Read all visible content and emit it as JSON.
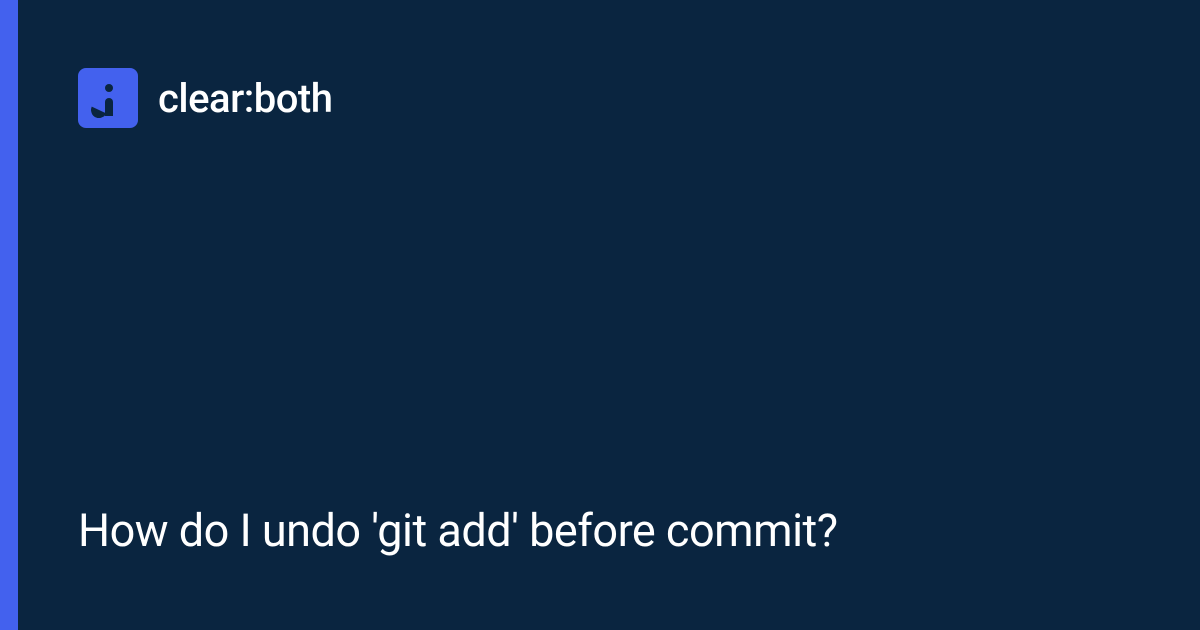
{
  "brand": {
    "name": "clear:both"
  },
  "page": {
    "title": "How do I undo 'git add' before commit?"
  },
  "colors": {
    "background": "#0a2540",
    "accent": "#4361ee",
    "text": "#ffffff"
  }
}
